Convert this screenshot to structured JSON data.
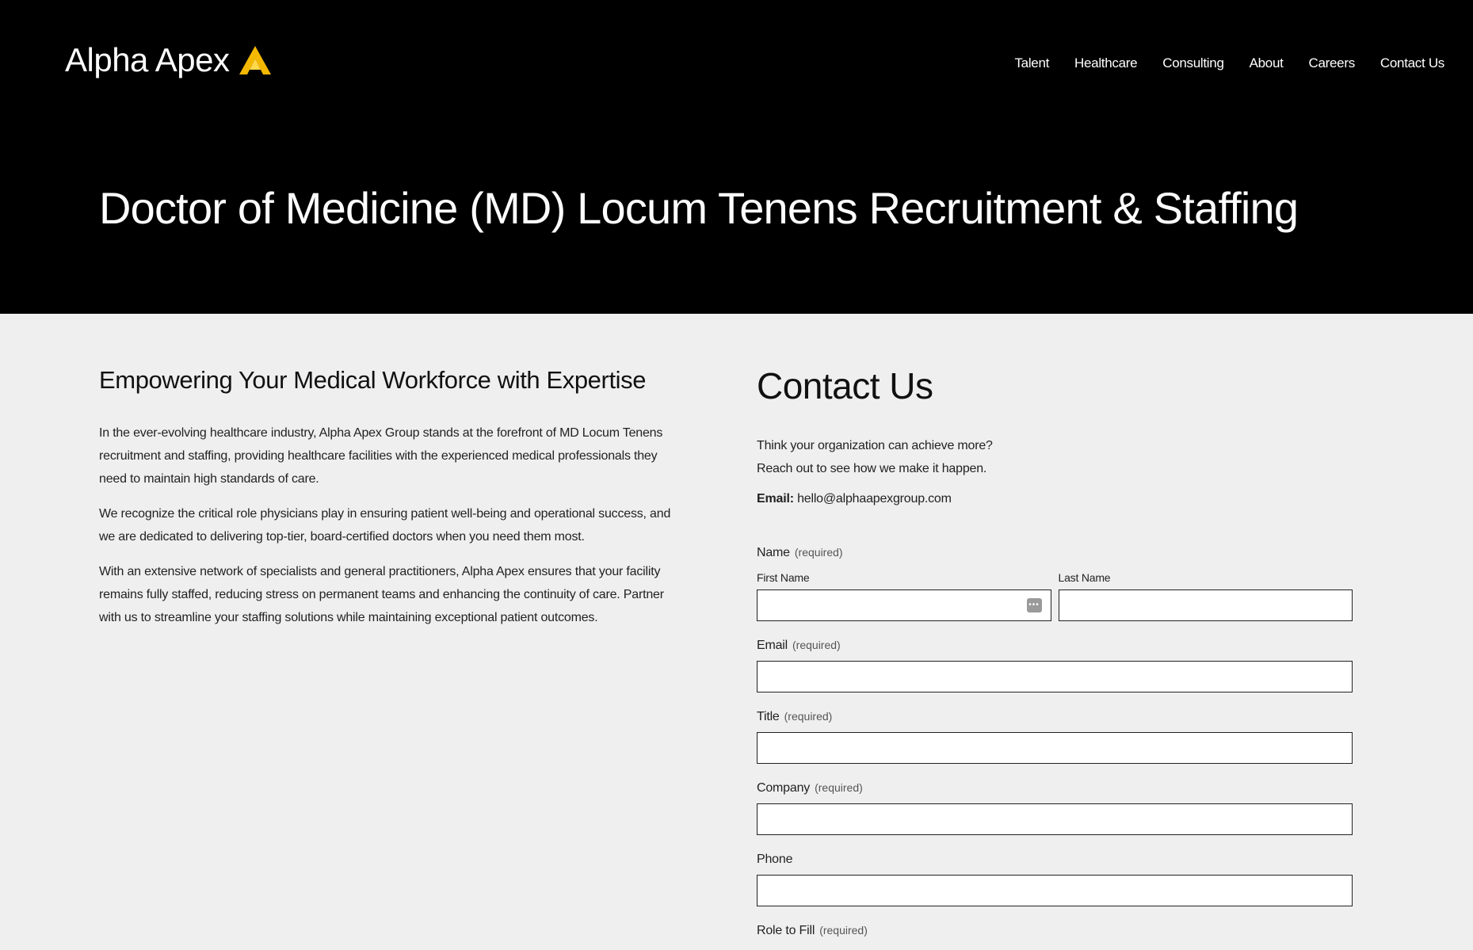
{
  "brand": {
    "name": "Alpha Apex",
    "accent_color": "#f5b800"
  },
  "nav": {
    "items": [
      {
        "label": "Talent"
      },
      {
        "label": "Healthcare"
      },
      {
        "label": "Consulting"
      },
      {
        "label": "About"
      },
      {
        "label": "Careers"
      },
      {
        "label": "Contact Us"
      }
    ]
  },
  "hero": {
    "title": "Doctor of Medicine (MD) Locum Tenens Recruitment & Staffing"
  },
  "intro": {
    "heading": "Empowering Your Medical Workforce with Expertise",
    "paragraphs": [
      "In the ever-evolving healthcare industry, Alpha Apex Group stands at the forefront of MD Locum Tenens recruitment and staffing, providing healthcare facilities with the experienced medical professionals they need to maintain high standards of care.",
      "We recognize the critical role physicians play in ensuring patient well-being and operational success, and we are dedicated to delivering top-tier, board-certified doctors when you need them most.",
      "With an extensive network of specialists and general practitioners, Alpha Apex ensures that your facility remains fully staffed, reducing stress on permanent teams and enhancing the continuity of care. Partner with us to streamline your staffing solutions while maintaining exceptional patient outcomes."
    ]
  },
  "contact": {
    "heading": "Contact Us",
    "line1": "Think your organization can achieve more?",
    "line2": "Reach out to see how we make it happen.",
    "email_label": "Email:",
    "email_value": "hello@alphaapexgroup.com"
  },
  "form": {
    "name_label": "Name",
    "required_text": "(required)",
    "first_name_label": "First Name",
    "last_name_label": "Last Name",
    "first_name_value": "",
    "last_name_value": "",
    "email_label": "Email",
    "email_value": "",
    "title_label": "Title",
    "title_value": "",
    "company_label": "Company",
    "company_value": "",
    "phone_label": "Phone",
    "phone_value": "",
    "role_label": "Role to Fill"
  }
}
